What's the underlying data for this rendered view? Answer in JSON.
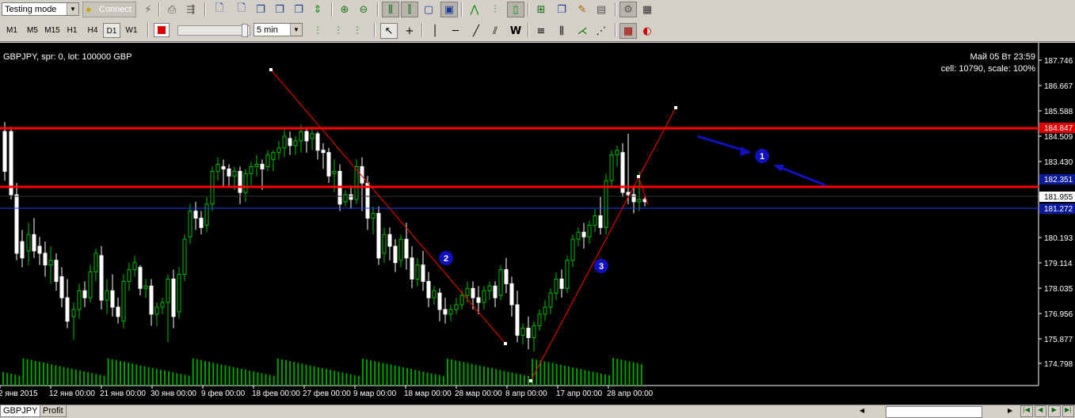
{
  "toolbar": {
    "mode_select": "Testing mode",
    "connect_label": "Connect",
    "timeframes": [
      "M1",
      "M5",
      "M15",
      "H1",
      "H4",
      "D1",
      "W1"
    ],
    "active_timeframe": "D1",
    "speed_select": "5 min"
  },
  "chart": {
    "symbol_info": "GBPJPY, spr: 0, lot: 100000 GBP",
    "datetime": "Май 05 Вт 23:59",
    "cell_info": "cell: 10790, scale: 100%",
    "price_labels": [
      "187.746",
      "186.667",
      "185.588",
      "184.509",
      "183.430",
      "181.955",
      "180.193",
      "179.114",
      "178.035",
      "176.956",
      "175.877",
      "174.798"
    ],
    "marker_level_red": "184.847",
    "marker_level_blue": "182.351",
    "marker_level_blue2": "181.272",
    "time_labels": [
      "2 янв 2015",
      "12 янв 00:00",
      "21 янв 00:00",
      "30 янв 00:00",
      "9 фев 00:00",
      "18 фев 00:00",
      "27 фев 00:00",
      "9 мар 00:00",
      "18 мар 00:00",
      "28 мар 00:00",
      "8 апр 00:00",
      "17 апр 00:00",
      "28 апр 00:00"
    ],
    "annotations": [
      "1",
      "2",
      "3"
    ]
  },
  "colors": {
    "bull": "#00c000",
    "bear": "#ffffff",
    "line": "#ff0000",
    "annotation": "#1010c0",
    "volume": "#00a000"
  },
  "tabs": [
    "GBPJPY",
    "Profit"
  ]
}
